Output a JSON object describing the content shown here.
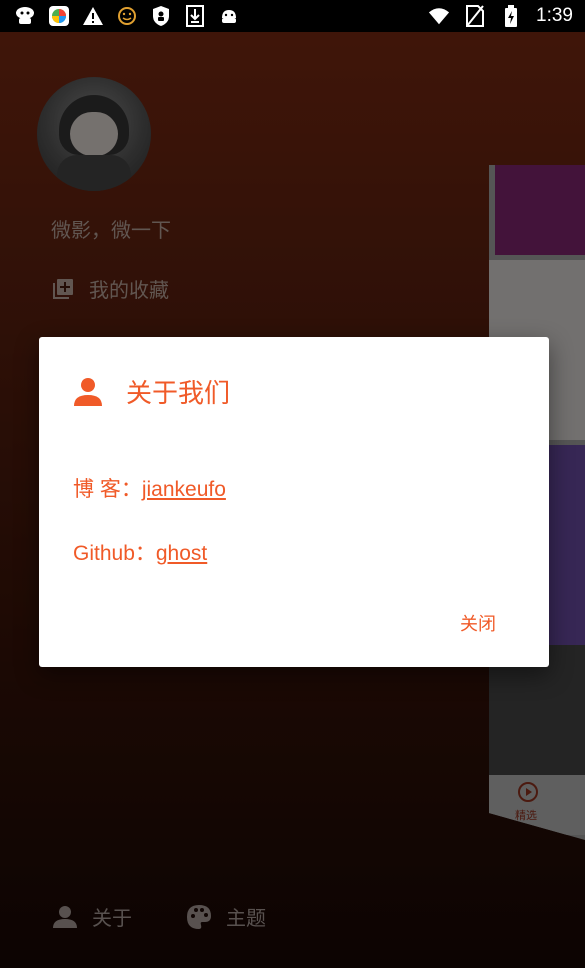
{
  "status_bar": {
    "time": "1:39",
    "icons": [
      "carrier-app-icon",
      "store-app-icon",
      "warning-icon",
      "smiley-icon",
      "shield-icon",
      "download-icon",
      "android-icon"
    ],
    "right_icons": [
      "wifi-icon",
      "no-sim-icon",
      "battery-icon"
    ]
  },
  "drawer": {
    "slogan": "微影，微一下",
    "favorites_label": "我的收藏",
    "bottom_nav": [
      {
        "label": "关于",
        "icon": "person-icon"
      },
      {
        "label": "主题",
        "icon": "palette-icon"
      }
    ]
  },
  "preview": {
    "nav_label": "精选"
  },
  "dialog": {
    "title": "关于我们",
    "blog_label": "博 客：",
    "blog_link": "jiankeufo",
    "github_label": "Github：",
    "github_link": "ghost",
    "close_label": "关闭",
    "accent_color": "#f05a28"
  }
}
